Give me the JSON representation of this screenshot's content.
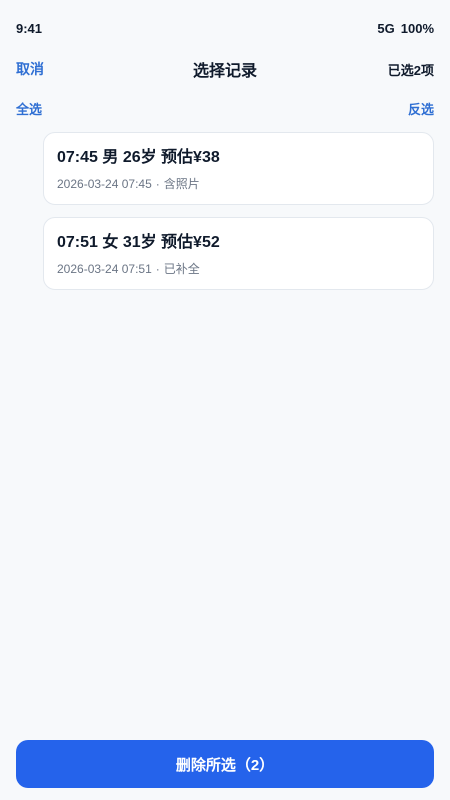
{
  "status_bar": {
    "time": "9:41",
    "network": "5G",
    "battery": "100%"
  },
  "nav": {
    "cancel": "取消",
    "title": "选择记录",
    "selected_count": "已选2项"
  },
  "selection": {
    "select_all": "全选",
    "invert": "反选"
  },
  "records": [
    {
      "title": "07:45 男 26岁 预估¥38",
      "datetime": "2026-03-24 07:45",
      "separator": "·",
      "tag": "含照片"
    },
    {
      "title": "07:51 女 31岁 预估¥52",
      "datetime": "2026-03-24 07:51",
      "separator": "·",
      "tag": "已补全"
    }
  ],
  "footer": {
    "delete_label": "删除所选（2）"
  },
  "colors": {
    "accent": "#2f6fd3",
    "primary_button": "#2563eb",
    "background": "#f7f9fb"
  }
}
